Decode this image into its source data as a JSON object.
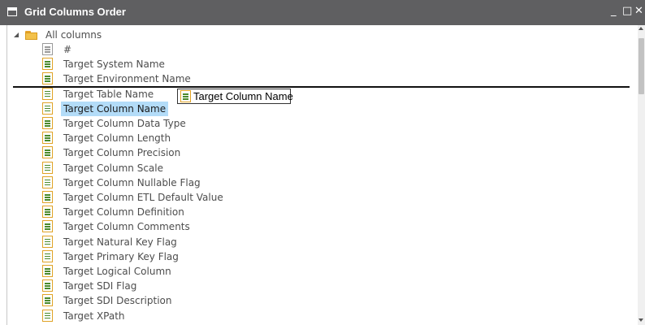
{
  "window": {
    "title": "Grid Columns Order",
    "minimize": "_",
    "maximize": "□",
    "close": "✕"
  },
  "tree": {
    "root_label": "All columns",
    "items": [
      {
        "label": "#",
        "icon": "hash-column-icon"
      },
      {
        "label": "Target System Name",
        "icon": "column-icon"
      },
      {
        "label": "Target Environment Name",
        "icon": "column-icon"
      },
      {
        "label": "Target Table Name",
        "icon": "column-icon"
      },
      {
        "label": "Target Column Name",
        "icon": "column-icon",
        "selected": true
      },
      {
        "label": "Target Column Data Type",
        "icon": "column-icon"
      },
      {
        "label": "Target Column Length",
        "icon": "column-icon"
      },
      {
        "label": "Target Column Precision",
        "icon": "column-icon"
      },
      {
        "label": "Target Column Scale",
        "icon": "column-icon"
      },
      {
        "label": "Target Column Nullable Flag",
        "icon": "column-icon"
      },
      {
        "label": "Target Column ETL Default Value",
        "icon": "column-icon"
      },
      {
        "label": "Target Column Definition",
        "icon": "column-icon"
      },
      {
        "label": "Target Column Comments",
        "icon": "column-icon"
      },
      {
        "label": "Target Natural Key Flag",
        "icon": "column-icon"
      },
      {
        "label": "Target Primary Key Flag",
        "icon": "column-icon"
      },
      {
        "label": "Target Logical Column",
        "icon": "column-icon"
      },
      {
        "label": "Target SDI Flag",
        "icon": "column-icon"
      },
      {
        "label": "Target SDI Description",
        "icon": "column-icon"
      },
      {
        "label": "Target XPath",
        "icon": "column-icon"
      }
    ]
  },
  "drag": {
    "label": "Target Column Name"
  },
  "colors": {
    "titlebar": "#5f5f61",
    "selection": "#b3dcf8",
    "icon_border": "#e0a326"
  }
}
